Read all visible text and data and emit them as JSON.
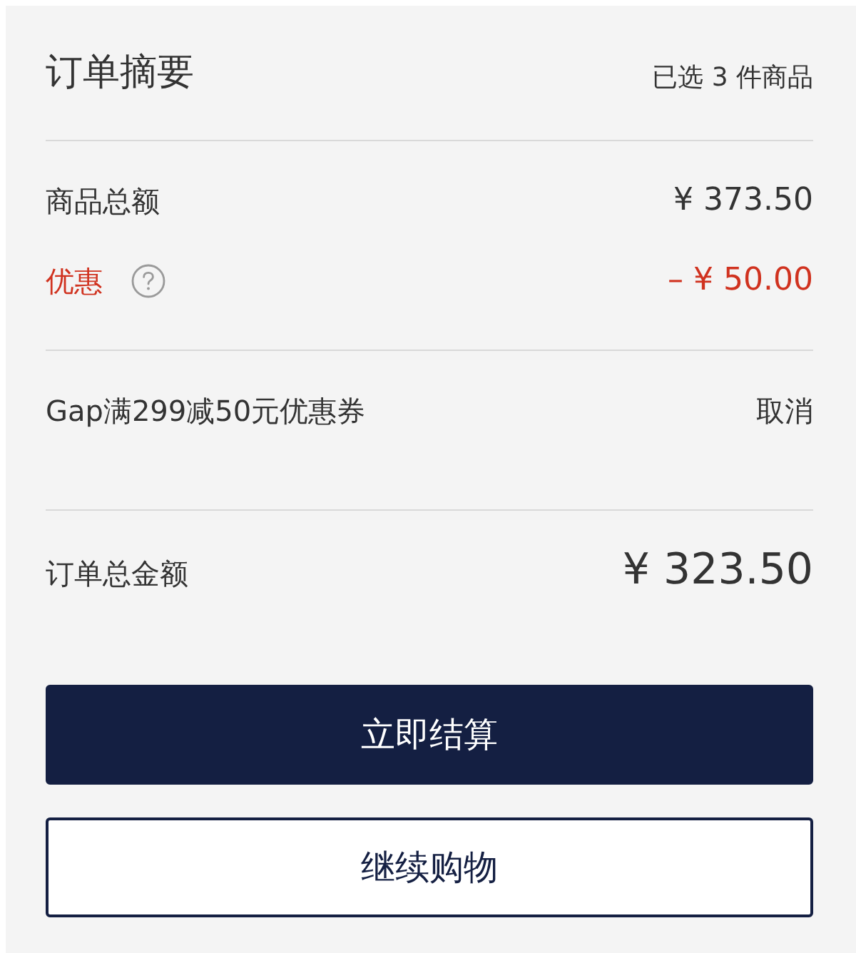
{
  "summary": {
    "title": "订单摘要",
    "selected_count": "已选 3 件商品"
  },
  "lines": [
    {
      "kind": "subtotal",
      "label": "商品总额",
      "amount": "¥ 373.50"
    },
    {
      "kind": "discount",
      "label": "优惠",
      "amount": "– ¥ 50.00"
    }
  ],
  "coupon": {
    "name": "Gap满299减50元优惠券",
    "action": "取消"
  },
  "total": {
    "label": "订单总金额",
    "amount": "¥ 323.50"
  },
  "buttons": [
    {
      "kind": "primary",
      "label": "立即结算"
    },
    {
      "kind": "secondary",
      "label": "继续购物"
    }
  ]
}
